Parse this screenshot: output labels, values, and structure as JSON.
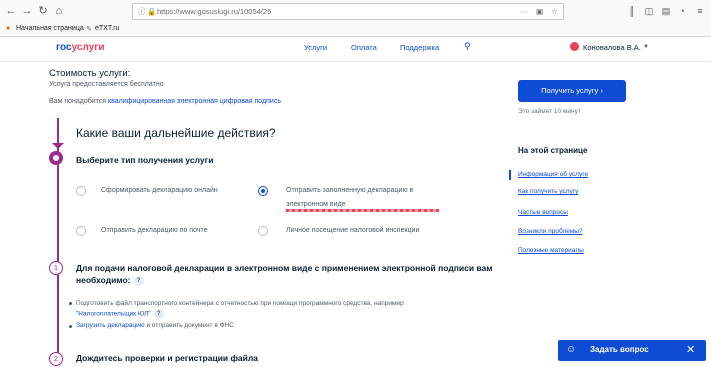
{
  "browser": {
    "url": "https://www.gosuslugi.ru/10054/25",
    "bookmarks": [
      "Начальная страница",
      "eTXT.ru"
    ]
  },
  "header": {
    "logo_part1": "гос",
    "logo_part2": "услуги",
    "nav": [
      "Услуги",
      "Оплата",
      "Поддержка"
    ],
    "user": "Коновалова В.А."
  },
  "main": {
    "cost_title": "Стоимость услуги:",
    "cost_text": "Услуга предоставляется бесплатно",
    "signature_prefix": "Вам понадобится ",
    "signature_link": "квалифицированная электронная цифровая подпись",
    "actions_title": "Какие ваши дальнейшие действия?",
    "choose_title": "Выберите тип получения услуги",
    "options": [
      "Сформировать декларацию онлайн",
      "Отправить заполненную декларацию в",
      "электронном виде",
      "Отправить декларацию по почте",
      "Личное посещение налоговой инспекции"
    ],
    "step2_number": "1",
    "docs_title": "Для подачи налоговой декларации в электронном виде с применением электронной подписи вам необходимо:",
    "bullet1_text": "Подготовить файл транспортного контейнера с отчетностью при помощи программного средства, например",
    "bullet1_link": "\"Налогоплательщик ЮЛ\"",
    "bullet2_link": "Загрузить декларацию",
    "bullet2_text": " и отправить документ в ФНС",
    "step3_number": "2",
    "next_title": "Дождитесь проверки и регистрации файла"
  },
  "sidebar": {
    "get_button": "Получить услугу",
    "time_note": "Это займет 10 минут",
    "onpage_title": "На этой странице",
    "links": [
      "Информация об услуге",
      "Как получить услугу",
      "Частые вопросы",
      "Возникли проблемы?",
      "Полезные материалы"
    ]
  },
  "chat": {
    "label": "Задать вопрос"
  },
  "colors": {
    "brand_blue": "#0d4cd3",
    "brand_red": "#ee3f58",
    "step_purple": "#9b2c8d"
  }
}
